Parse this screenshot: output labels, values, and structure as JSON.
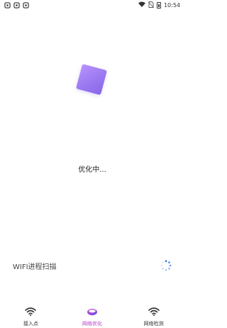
{
  "status_bar": {
    "time": "10:54",
    "notification_icons": [
      "app-notification-icon",
      "app-notification-icon",
      "app-notification-icon"
    ],
    "system_icons": [
      "wifi-icon",
      "no-sim-icon",
      "battery-icon"
    ]
  },
  "main": {
    "status_text": "优化中..."
  },
  "scan": {
    "label": "WIFI进程扫描"
  },
  "bottom_nav": {
    "items": [
      {
        "label": "接入点",
        "icon": "wifi-icon"
      },
      {
        "label": "网络优化",
        "icon": "optimize-ring-icon"
      },
      {
        "label": "网络检测",
        "icon": "wifi-icon"
      }
    ]
  },
  "colors": {
    "accent": "#b23cc4",
    "loader": "#9a79f0",
    "spinner": "#3b7be8"
  }
}
